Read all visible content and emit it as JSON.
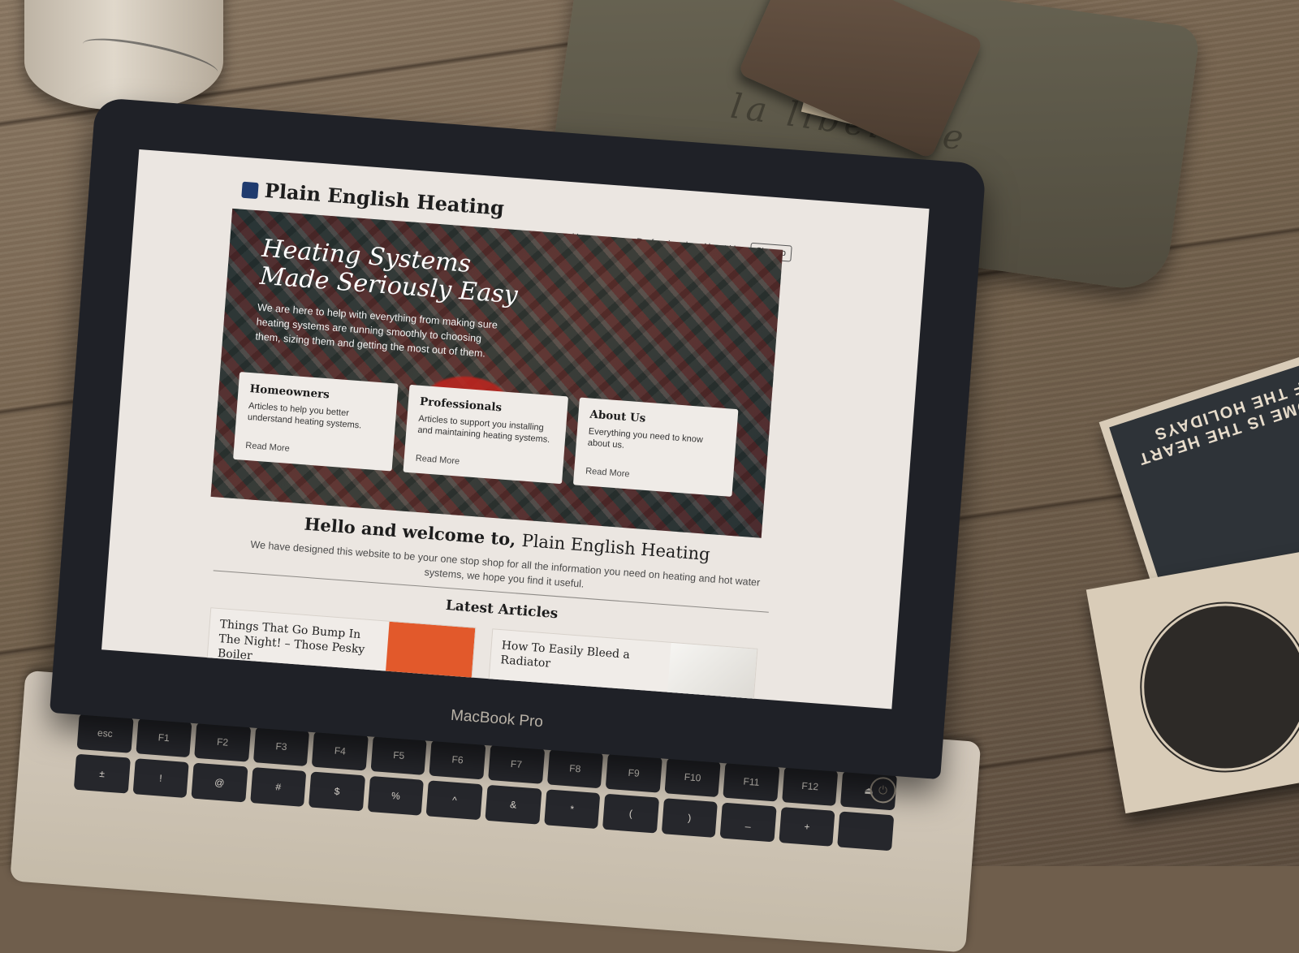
{
  "site": {
    "logo_text": "Plain English Heating",
    "nav": [
      "Homeowners",
      "Professionals",
      "About Us"
    ],
    "signup_label": "Sign up"
  },
  "hero": {
    "title": "Heating Systems Made Seriously Easy",
    "text": "We are here to help with everything from making sure heating systems are running smoothly to choosing them, sizing them and getting the most out of them."
  },
  "cards": [
    {
      "title": "Homeowners",
      "text": "Articles to help you better understand heating systems.",
      "link": "Read More"
    },
    {
      "title": "Professionals",
      "text": "Articles to support you installing and maintaining heating systems.",
      "link": "Read More"
    },
    {
      "title": "About Us",
      "text": "Everything you need to know about us.",
      "link": "Read More"
    }
  ],
  "welcome": {
    "heading_prefix": "Hello and welcome to,",
    "heading_brand": "Plain English Heating",
    "text": "We have designed this website to be your one stop shop for all the information you need on heating and hot water systems, we hope you find it useful."
  },
  "latest": {
    "heading": "Latest Articles",
    "articles": [
      {
        "title": "Things That Go Bump In The Night! – Those Pesky Boiler"
      },
      {
        "title": "How To Easily Bleed a Radiator"
      }
    ]
  },
  "device": {
    "brand_label": "MacBook Pro"
  },
  "keyboard": {
    "row1": [
      "esc",
      "F1",
      "F2",
      "F3",
      "F4",
      "F5",
      "F6",
      "F7",
      "F8",
      "F9",
      "F10",
      "F11",
      "F12",
      "⏏"
    ],
    "row2": [
      "±",
      "!",
      "@",
      "#",
      "$",
      "%",
      "^",
      "&",
      "*",
      "(",
      ")",
      "_",
      "+",
      ""
    ]
  },
  "props": {
    "pouch_text": "la libellule",
    "coaster_text": "HOME IS THE HEART OF THE HOLIDAYS"
  },
  "colors": {
    "logo_blue": "#1f3b6e",
    "screen_bg": "#ebe6e1",
    "article_orange": "#e2592b"
  }
}
